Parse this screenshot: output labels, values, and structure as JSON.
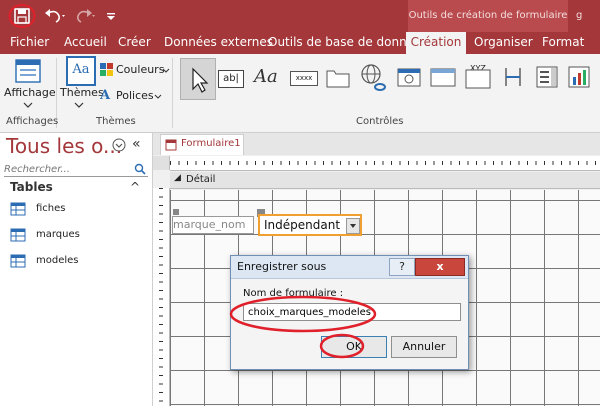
{
  "titlebar": {
    "tools_banner": "Outils de création de formulaire",
    "doc_title_fragment": "g"
  },
  "menu": {
    "items": [
      "Fichier",
      "Accueil",
      "Créer",
      "Données externes",
      "Outils de base de données",
      "Création",
      "Organiser",
      "Format"
    ],
    "active": "Création"
  },
  "ribbon": {
    "affichage_label": "Affichage",
    "themes_label": "Thèmes",
    "couleurs_label": "Couleurs",
    "polices_label": "Polices",
    "group_affichages": "Affichages",
    "group_themes": "Thèmes",
    "group_controles": "Contrôles",
    "label_tool_text": "Aa",
    "textbox_tool_text": "ab|",
    "xxxx_tool_text": "xxxx",
    "xyz_tool_text": "XYZ"
  },
  "nav": {
    "title": "Tous les o...",
    "search_placeholder": "Rechercher...",
    "section": "Tables",
    "items": [
      "fiches",
      "marques",
      "modeles"
    ]
  },
  "document": {
    "tab_label": "Formulaire1",
    "section_label": "Détail",
    "label_control_text": "marque_nom",
    "combo_value": "Indépendant"
  },
  "dialog": {
    "title": "Enregistrer sous",
    "help_btn": "?",
    "close_btn": "x",
    "field_label": "Nom de formulaire :",
    "field_value": "choix_marques_modeles",
    "ok_label": "OK",
    "cancel_label": "Annuler"
  },
  "colors": {
    "brand": "#a4373a",
    "highlight_circle": "#e0202a",
    "selection": "#f0a030"
  }
}
